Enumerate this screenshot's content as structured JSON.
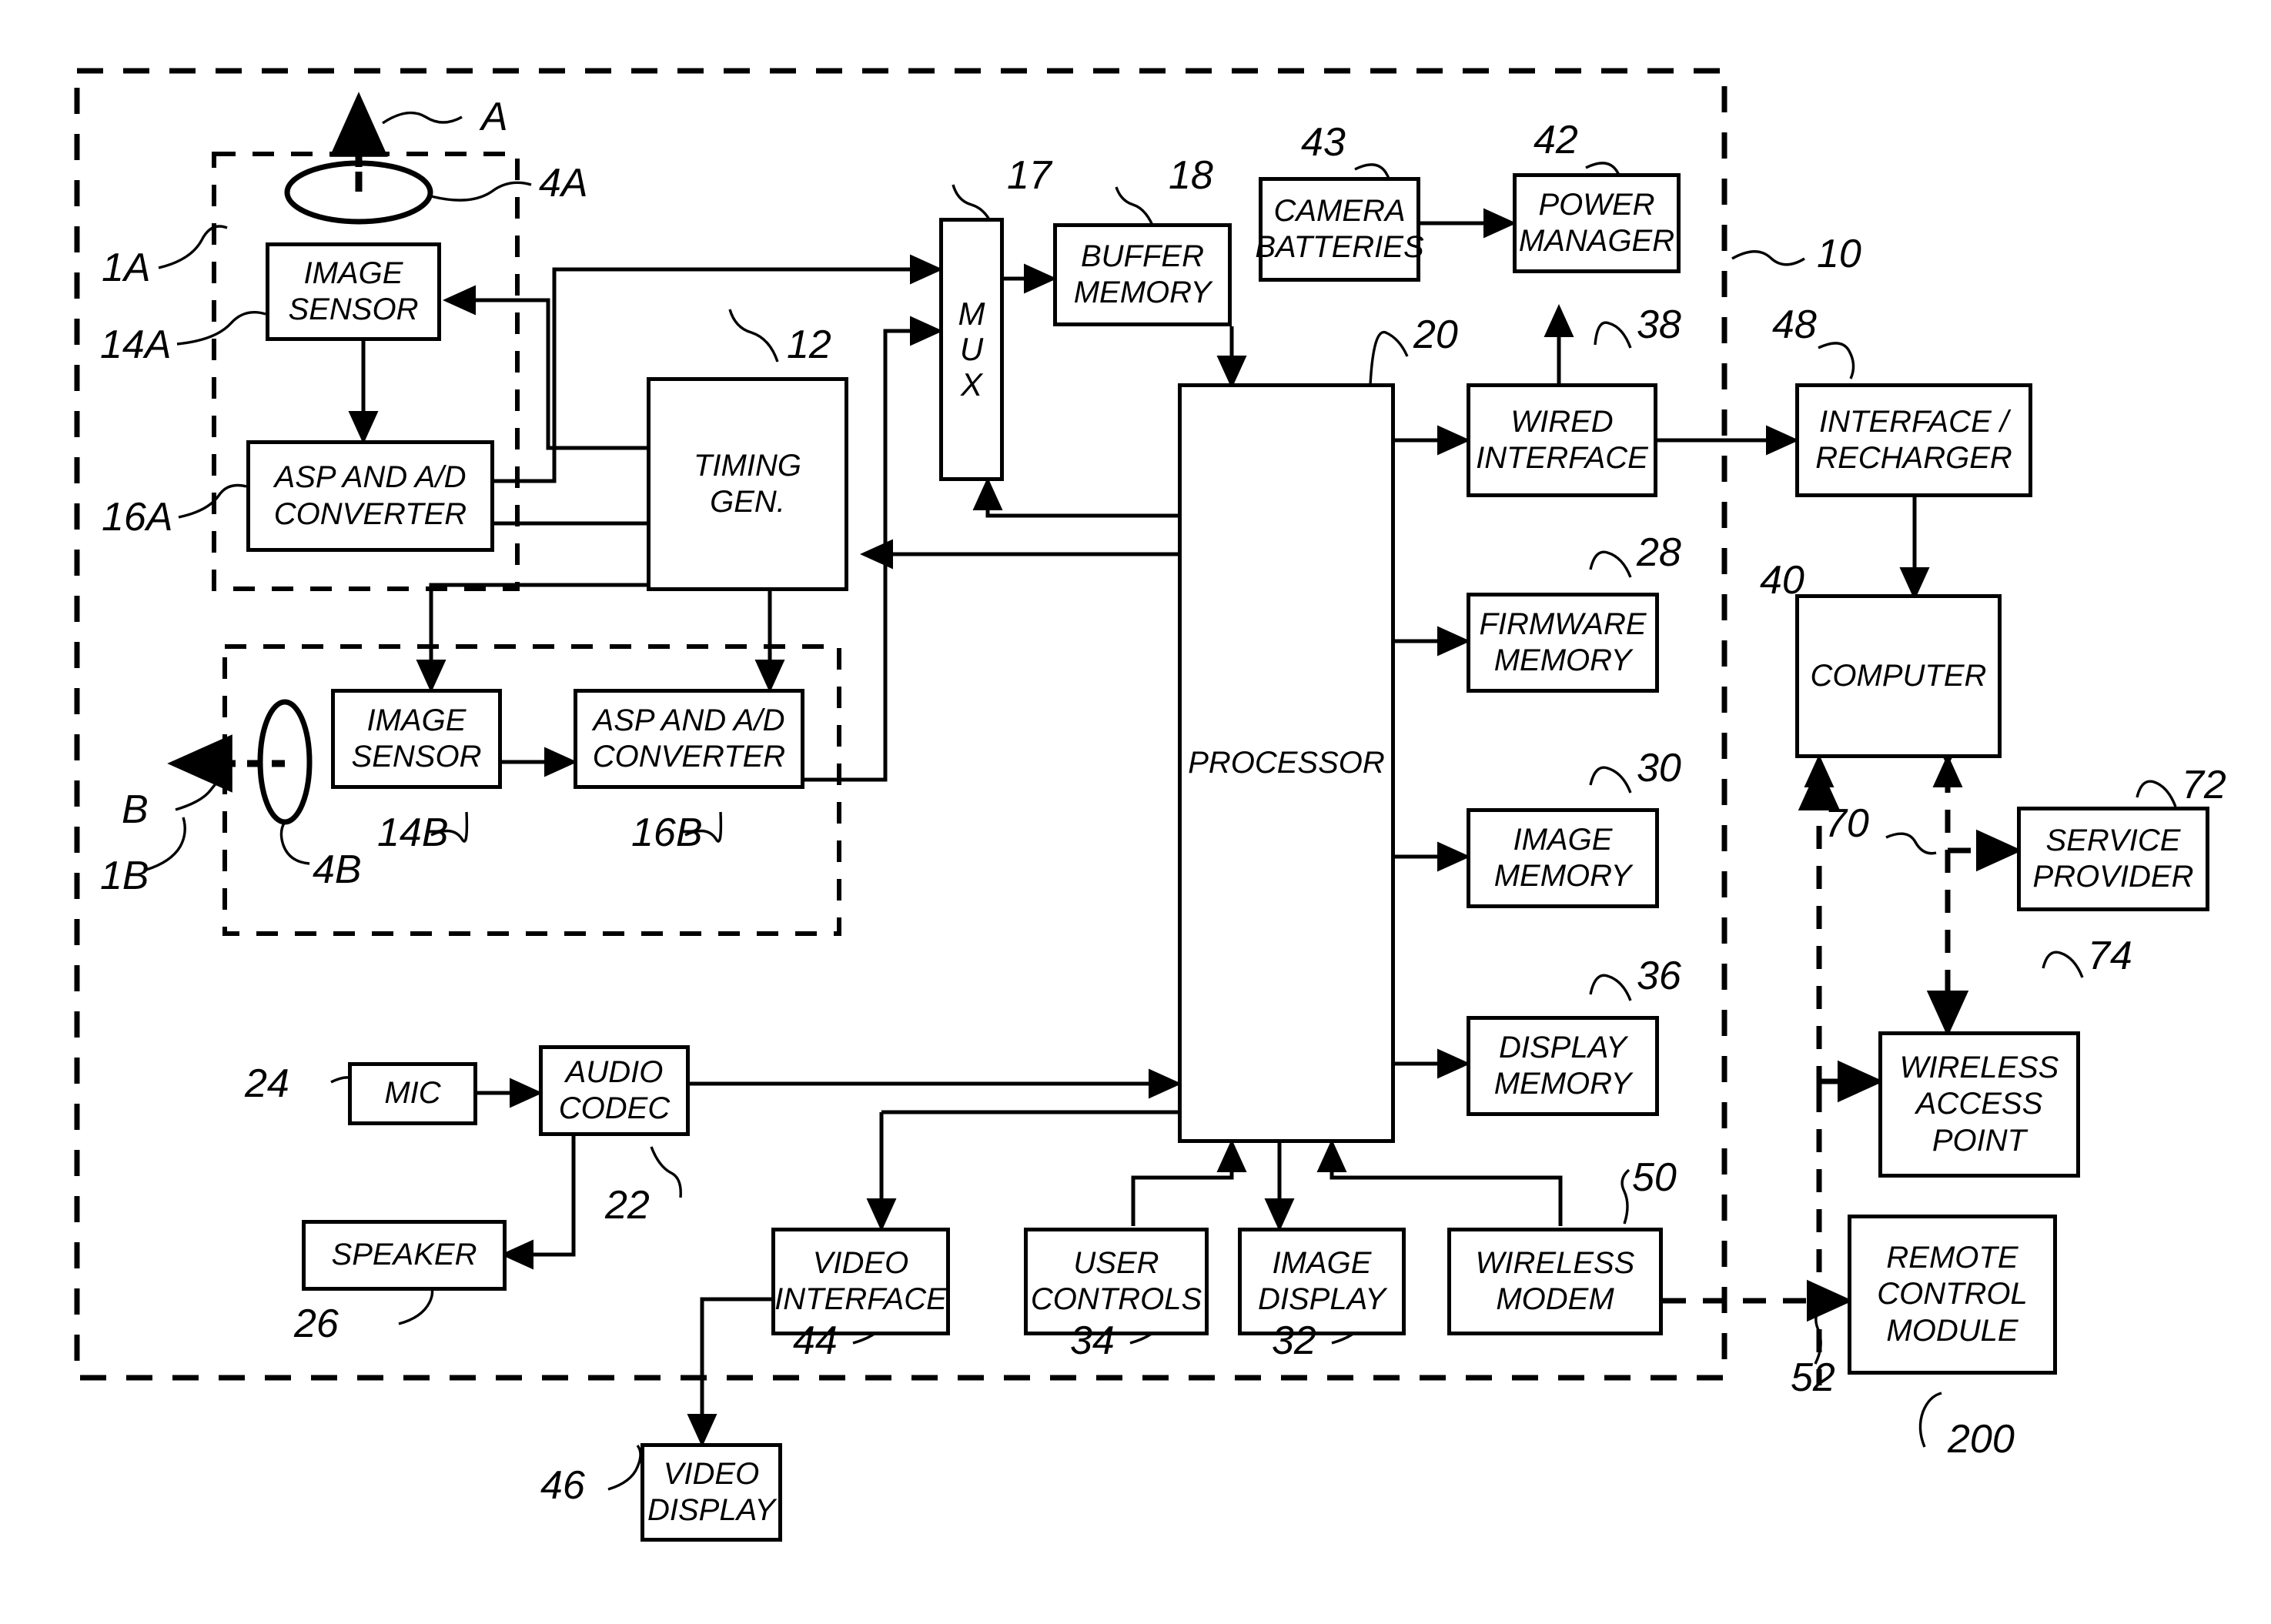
{
  "figure": {
    "title": "Digital camera system block diagram",
    "kind": "patent-block-diagram"
  },
  "blocks": [
    {
      "id": "image_sensor_a",
      "label": "IMAGE\nSENSOR",
      "ref": "14A"
    },
    {
      "id": "asp_ad_a",
      "label": "ASP AND A/D\nCONVERTER",
      "ref": "16A"
    },
    {
      "id": "timing_gen",
      "label": "TIMING\nGEN.",
      "ref": "12"
    },
    {
      "id": "mux",
      "label": "M\nU\nX",
      "ref": "17"
    },
    {
      "id": "buffer_memory",
      "label": "BUFFER\nMEMORY",
      "ref": "18"
    },
    {
      "id": "camera_batteries",
      "label": "CAMERA\nBATTERIES",
      "ref": "43"
    },
    {
      "id": "power_manager",
      "label": "POWER\nMANAGER",
      "ref": "42"
    },
    {
      "id": "wired_interface",
      "label": "WIRED\nINTERFACE",
      "ref": "38"
    },
    {
      "id": "interface_recharger",
      "label": "INTERFACE /\nRECHARGER",
      "ref": "48"
    },
    {
      "id": "computer",
      "label": "COMPUTER",
      "ref": "40"
    },
    {
      "id": "service_provider",
      "label": "SERVICE\nPROVIDER",
      "ref": "72"
    },
    {
      "id": "wireless_access_point",
      "label": "WIRELESS\nACCESS\nPOINT",
      "ref": "74"
    },
    {
      "id": "processor",
      "label": "PROCESSOR",
      "ref": "20"
    },
    {
      "id": "firmware_memory",
      "label": "FIRMWARE\nMEMORY",
      "ref": "28"
    },
    {
      "id": "image_memory",
      "label": "IMAGE\nMEMORY",
      "ref": "30"
    },
    {
      "id": "display_memory",
      "label": "DISPLAY\nMEMORY",
      "ref": "36"
    },
    {
      "id": "image_sensor_b",
      "label": "IMAGE\nSENSOR",
      "ref": "14B"
    },
    {
      "id": "asp_ad_b",
      "label": "ASP AND A/D\nCONVERTER",
      "ref": "16B"
    },
    {
      "id": "mic",
      "label": "MIC",
      "ref": "24"
    },
    {
      "id": "audio_codec",
      "label": "AUDIO\nCODEC",
      "ref": "22"
    },
    {
      "id": "speaker",
      "label": "SPEAKER",
      "ref": "26"
    },
    {
      "id": "video_interface",
      "label": "VIDEO\nINTERFACE",
      "ref": "44"
    },
    {
      "id": "user_controls",
      "label": "USER\nCONTROLS",
      "ref": "34"
    },
    {
      "id": "image_display",
      "label": "IMAGE\nDISPLAY",
      "ref": "32"
    },
    {
      "id": "wireless_modem",
      "label": "WIRELESS\nMODEM",
      "ref": "50"
    },
    {
      "id": "video_display",
      "label": "VIDEO\nDISPLAY",
      "ref": "46"
    },
    {
      "id": "remote_control_module",
      "label": "REMOTE\nCONTROL\nMODULE",
      "ref": "200"
    }
  ],
  "reference_numerals": {
    "camera_system": "10",
    "lens_assembly_a": "1A",
    "lens_a": "4A",
    "optical_axis_a": "A",
    "image_sensor_a": "14A",
    "asp_ad_a": "16A",
    "timing_gen": "12",
    "mux": "17",
    "buffer_memory": "18",
    "camera_batteries": "43",
    "power_manager": "42",
    "processor": "20",
    "wired_interface": "38",
    "interface_recharger": "48",
    "computer": "40",
    "dashed_network_link": "70",
    "service_provider": "72",
    "wireless_access_point": "74",
    "firmware_memory": "28",
    "image_memory": "30",
    "display_memory": "36",
    "lens_assembly_b": "1B",
    "lens_b": "4B",
    "optical_axis_b": "B",
    "image_sensor_b": "14B",
    "asp_ad_b": "16B",
    "mic": "24",
    "audio_codec": "22",
    "speaker": "26",
    "video_interface": "44",
    "user_controls": "34",
    "image_display": "32",
    "wireless_modem": "50",
    "video_display": "46",
    "remote_link": "52",
    "remote_control_module": "200"
  },
  "colors": {
    "stroke": "#000000",
    "background": "#ffffff"
  }
}
